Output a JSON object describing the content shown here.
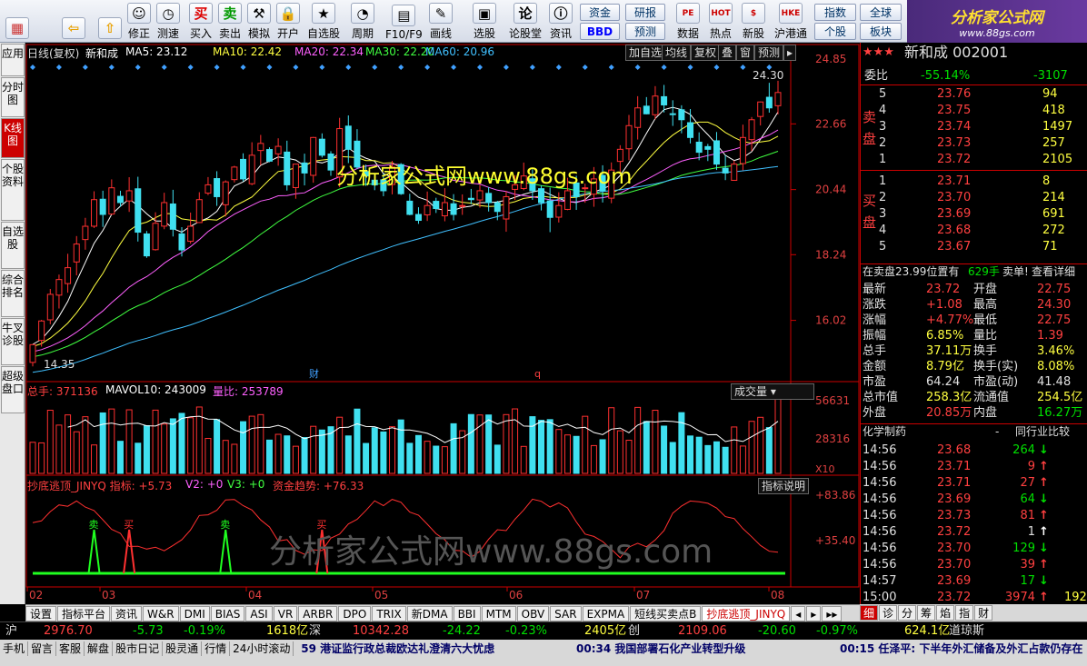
{
  "toolbar": {
    "buttons": [
      {
        "name": "menu-button",
        "label": "",
        "icon": "grid-icon"
      },
      {
        "name": "back-button",
        "label": "",
        "icon": "back-arrow-icon"
      },
      {
        "name": "up-button",
        "label": "",
        "icon": "up-arrow-icon"
      },
      {
        "name": "modify-button",
        "label": "修正",
        "icon": "smiley-icon"
      },
      {
        "name": "measure-button",
        "label": "测速",
        "icon": "clock-icon"
      },
      {
        "name": "buy-button",
        "label": "买入",
        "icon": "buy-icon",
        "glyph": "买"
      },
      {
        "name": "sell-button",
        "label": "卖出",
        "icon": "sell-icon",
        "glyph": "卖"
      },
      {
        "name": "simulate-button",
        "label": "模拟",
        "icon": "hammer-icon"
      },
      {
        "name": "open-account-button",
        "label": "开户",
        "icon": "lock-icon"
      },
      {
        "name": "watchlist-button",
        "label": "自选股",
        "icon": "star-list-icon"
      },
      {
        "name": "period-button",
        "label": "周期",
        "icon": "period-icon"
      },
      {
        "name": "f10-button",
        "label": "F10/F9",
        "icon": "document-icon"
      },
      {
        "name": "draw-button",
        "label": "画线",
        "icon": "pen-icon"
      },
      {
        "name": "select-stock-button",
        "label": "选股",
        "icon": "select-icon"
      },
      {
        "name": "forum-button",
        "label": "论股堂",
        "icon": "forum-icon",
        "glyph": "论"
      },
      {
        "name": "info-button",
        "label": "资讯",
        "icon": "info-icon"
      }
    ],
    "small_buttons": [
      {
        "name": "fund-button",
        "label": "资金"
      },
      {
        "name": "bbd-button",
        "label": "BBD"
      },
      {
        "name": "research-button",
        "label": "研报"
      },
      {
        "name": "forecast-button",
        "label": "预测"
      },
      {
        "name": "data-button",
        "label": "数据",
        "glyph": "PE"
      },
      {
        "name": "hot-button",
        "label": "热点",
        "glyph": "HOT"
      },
      {
        "name": "new-stock-button",
        "label": "新股",
        "glyph": "$"
      },
      {
        "name": "hk-connect-button",
        "label": "沪港通",
        "glyph": "HKE"
      },
      {
        "name": "index-button",
        "label": "指数"
      },
      {
        "name": "individual-button",
        "label": "个股"
      },
      {
        "name": "global-button",
        "label": "全球"
      },
      {
        "name": "sector-button",
        "label": "板块"
      }
    ],
    "logo_line1": "分析家公式网",
    "logo_line2": "www.88gs.com"
  },
  "left_tabs": [
    {
      "label": "应用",
      "active": false
    },
    {
      "label": "分时图",
      "active": false
    },
    {
      "label": "K线图",
      "active": true
    },
    {
      "label": "个股资料",
      "active": false
    },
    {
      "label": "自选股",
      "active": false
    },
    {
      "label": "综合排名",
      "active": false
    },
    {
      "label": "牛叉诊股",
      "active": false
    },
    {
      "label": "超级盘口",
      "active": false
    }
  ],
  "chart": {
    "title": "日线(复权)",
    "stock": "新和成",
    "ma5": "MA5: 23.12",
    "ma10": "MA10: 22.42",
    "ma20": "MA20: 22.34",
    "ma30": "MA30: 22.20",
    "ma60": "MA60: 20.96",
    "buttons": [
      "加自选",
      "均线",
      "复权",
      "叠",
      "窗",
      "预测"
    ],
    "price_axis": [
      "24.85",
      "22.66",
      "20.44",
      "18.24",
      "16.02"
    ],
    "high_label": "24.30",
    "low_label": "14.35",
    "event_labels": [
      "财",
      "q"
    ],
    "vol_hdr_total": "总手: 371136",
    "vol_hdr_mavol": "MAVOL10: 243009",
    "vol_hdr_ratio": "量比: 253789",
    "vol_dropdown": "成交量",
    "vol_axis": [
      "56631",
      "28316"
    ],
    "vol_unit": "X10",
    "ind_hdr_name": "抄底逃顶_JINYQ 指标: +5.73",
    "ind_hdr_v2": "V2: +0",
    "ind_hdr_v3": "V3: +0",
    "ind_hdr_trend": "资金趋势: +76.33",
    "ind_help": "指标说明",
    "ind_axis": [
      "+83.86",
      "+35.40"
    ],
    "signal_buy": "买",
    "signal_sell": "卖",
    "date_axis": [
      "02",
      "03",
      "04",
      "05",
      "06",
      "07",
      "08"
    ],
    "watermark_top": "分析家公式网www.88gs.com",
    "watermark_bottom": "分析家公式网www.88gs.com"
  },
  "chart_data": {
    "type": "candlestick",
    "title": "",
    "x_months": [
      "02",
      "03",
      "04",
      "05",
      "06",
      "07",
      "08"
    ],
    "ylim": [
      14.35,
      24.85
    ],
    "close": [
      15.2,
      16.0,
      16.9,
      17.4,
      17.8,
      18.6,
      19.2,
      20.1,
      19.6,
      20.5,
      20.0,
      20.4,
      19.0,
      18.2,
      19.3,
      20.0,
      19.1,
      18.4,
      19.2,
      20.1,
      20.6,
      20.2,
      20.7,
      21.2,
      20.8,
      21.6,
      22.0,
      21.4,
      21.9,
      20.6,
      21.3,
      21.0,
      22.2,
      21.6,
      21.1,
      22.5,
      21.8,
      21.2,
      20.9,
      20.6,
      20.4,
      21.2,
      20.3,
      19.6,
      19.4,
      19.9,
      19.8,
      20.0,
      19.6,
      19.9,
      20.1,
      20.4,
      20.0,
      19.7,
      20.2,
      20.6,
      20.9,
      20.4,
      20.0,
      19.5,
      19.9,
      20.4,
      20.2,
      20.5,
      20.8,
      20.4,
      21.1,
      21.8,
      22.6,
      23.2,
      23.0,
      23.6,
      23.3,
      23.0,
      22.8,
      22.2,
      21.7,
      21.8,
      21.3,
      21.0,
      21.3,
      22.2,
      22.8,
      23.4,
      23.2,
      23.72
    ],
    "volume_hint": "volume bars per session (x10)",
    "indicator": "抄底逃顶_JINYQ"
  },
  "right_panel": {
    "stock_title": "新和成 002001",
    "stars": "★★★",
    "weibi_label": "委比",
    "weibi": "-55.14%",
    "weicha": "-3107",
    "sell_label": "卖盘",
    "buy_label": "买盘",
    "sells": [
      {
        "n": "5",
        "p": "23.76",
        "v": "94"
      },
      {
        "n": "4",
        "p": "23.75",
        "v": "418"
      },
      {
        "n": "3",
        "p": "23.74",
        "v": "1497"
      },
      {
        "n": "2",
        "p": "23.73",
        "v": "257"
      },
      {
        "n": "1",
        "p": "23.72",
        "v": "2105"
      }
    ],
    "buys": [
      {
        "n": "1",
        "p": "23.71",
        "v": "8"
      },
      {
        "n": "2",
        "p": "23.70",
        "v": "214"
      },
      {
        "n": "3",
        "p": "23.69",
        "v": "691"
      },
      {
        "n": "4",
        "p": "23.68",
        "v": "272"
      },
      {
        "n": "5",
        "p": "23.67",
        "v": "71"
      }
    ],
    "info_line_a": "在卖盘23.99位置有",
    "info_line_b": "629手",
    "info_line_c": "卖单!",
    "info_line_d": "查看详细",
    "quote": [
      {
        "l1": "最新",
        "v1": "23.72",
        "c1": "red",
        "l2": "开盘",
        "v2": "22.75",
        "c2": "red"
      },
      {
        "l1": "涨跌",
        "v1": "+1.08",
        "c1": "red",
        "l2": "最高",
        "v2": "24.30",
        "c2": "red"
      },
      {
        "l1": "涨幅",
        "v1": "+4.77%",
        "c1": "red",
        "l2": "最低",
        "v2": "22.75",
        "c2": "red"
      },
      {
        "l1": "振幅",
        "v1": "6.85%",
        "c1": "yel",
        "l2": "量比",
        "v2": "1.39",
        "c2": "red"
      },
      {
        "l1": "总手",
        "v1": "37.11万",
        "c1": "yel",
        "l2": "换手",
        "v2": "3.46%",
        "c2": "yel"
      },
      {
        "l1": "金额",
        "v1": "8.79亿",
        "c1": "yel",
        "l2": "换手(实)",
        "v2": "8.08%",
        "c2": "yel"
      },
      {
        "l1": "市盈",
        "v1": "64.24",
        "c1": "wht",
        "l2": "市盈(动)",
        "v2": "41.48",
        "c2": "wht"
      },
      {
        "l1": "总市值",
        "v1": "258.3亿",
        "c1": "yel",
        "l2": "流通值",
        "v2": "254.5亿",
        "c2": "yel"
      },
      {
        "l1": "外盘",
        "v1": "20.85万",
        "c1": "red",
        "l2": "内盘",
        "v2": "16.27万",
        "c2": "grn"
      }
    ],
    "industry": "化学制药",
    "industry_dash": "-",
    "industry_compare": "同行业比较",
    "ticks": [
      {
        "t": "14:56",
        "p": "23.68",
        "v": "264",
        "d": "down",
        "x": ""
      },
      {
        "t": "14:56",
        "p": "23.71",
        "v": "9",
        "d": "up",
        "x": ""
      },
      {
        "t": "14:56",
        "p": "23.71",
        "v": "27",
        "d": "up",
        "x": ""
      },
      {
        "t": "14:56",
        "p": "23.69",
        "v": "64",
        "d": "down",
        "x": ""
      },
      {
        "t": "14:56",
        "p": "23.73",
        "v": "81",
        "d": "up",
        "x": ""
      },
      {
        "t": "14:56",
        "p": "23.72",
        "v": "1",
        "d": "flat",
        "x": ""
      },
      {
        "t": "14:56",
        "p": "23.70",
        "v": "129",
        "d": "down",
        "x": ""
      },
      {
        "t": "14:56",
        "p": "23.70",
        "v": "39",
        "d": "up",
        "x": ""
      },
      {
        "t": "14:57",
        "p": "23.69",
        "v": "17",
        "d": "down",
        "x": ""
      },
      {
        "t": "15:00",
        "p": "23.72",
        "v": "3974",
        "d": "up",
        "x": "192"
      }
    ]
  },
  "bottom_tabs": [
    {
      "label": "设置",
      "active": false
    },
    {
      "label": "指标平台",
      "active": false
    },
    {
      "label": "资讯",
      "active": false
    },
    {
      "label": "W&R",
      "active": false
    },
    {
      "label": "DMI",
      "active": false
    },
    {
      "label": "BIAS",
      "active": false
    },
    {
      "label": "ASI",
      "active": false
    },
    {
      "label": "VR",
      "active": false
    },
    {
      "label": "ARBR",
      "active": false
    },
    {
      "label": "DPO",
      "active": false
    },
    {
      "label": "TRIX",
      "active": false
    },
    {
      "label": "新DMA",
      "active": false
    },
    {
      "label": "BBI",
      "active": false
    },
    {
      "label": "MTM",
      "active": false
    },
    {
      "label": "OBV",
      "active": false
    },
    {
      "label": "SAR",
      "active": false
    },
    {
      "label": "EXPMA",
      "active": false
    },
    {
      "label": "短线买卖点B",
      "active": false
    },
    {
      "label": "抄底逃顶_JINYQ",
      "active": true
    }
  ],
  "right_tabs": [
    {
      "label": "细",
      "active": true
    },
    {
      "label": "诊",
      "active": false
    },
    {
      "label": "分",
      "active": false
    },
    {
      "label": "筹",
      "active": false
    },
    {
      "label": "焰",
      "active": false
    },
    {
      "label": "指",
      "active": false
    },
    {
      "label": "财",
      "active": false
    }
  ],
  "index_bar": {
    "sh_label": "沪",
    "sh_value": "2976.70",
    "sh_change": "-5.73",
    "sh_pct": "-0.19%",
    "sh_amount": "1618亿",
    "sz_label": "深",
    "sz_value": "10342.28",
    "sz_change": "-24.22",
    "sz_pct": "-0.23%",
    "sz_amount": "2405亿",
    "cy_label": "创",
    "cy_value": "2109.06",
    "cy_change": "-20.60",
    "cy_pct": "-0.97%",
    "cy_amount": "624.1亿",
    "dj_label": "道琼斯"
  },
  "status_bar": {
    "buttons": [
      "手机",
      "留言",
      "客服",
      "解盘",
      "股市日记",
      "股灵通",
      "行情",
      "24小时滚动"
    ],
    "news1": "59 港证监行政总裁欧达礼澄清六大忧虑",
    "news2": "00:34 我国部署石化产业转型升级",
    "news3": "00:15 任泽平: 下半年外汇储备及外汇占款仍存在"
  }
}
